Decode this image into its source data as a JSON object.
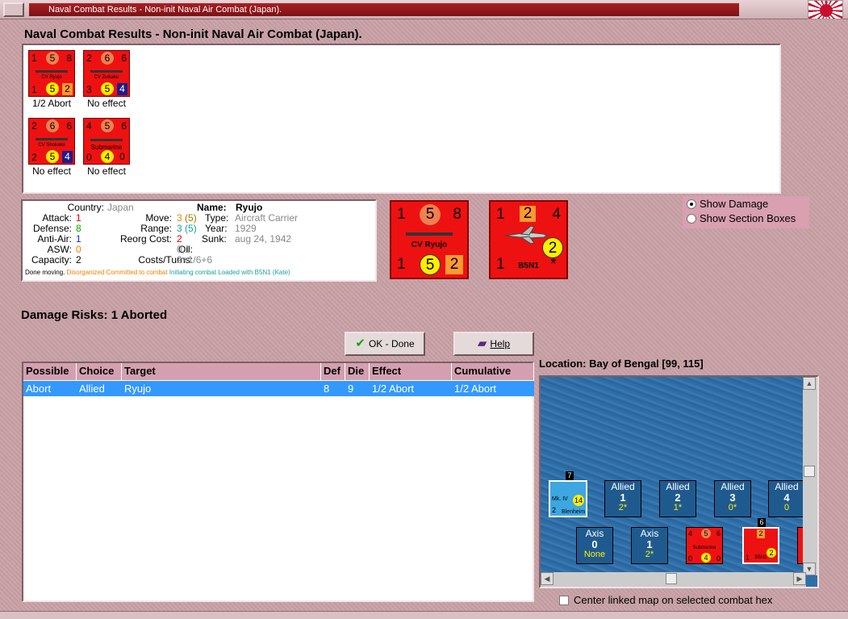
{
  "window": {
    "title": "Naval Combat Results - Non-init Naval Air Combat (Japan)."
  },
  "heading": "Naval Combat Results - Non-init Naval Air Combat (Japan).",
  "results": [
    {
      "tl": "1",
      "tc": "5",
      "tr": "8",
      "name": "CV Ryujo",
      "bl": "1",
      "bc": "5",
      "br": "2",
      "br_color": "orange",
      "label": "1/2 Abort"
    },
    {
      "tl": "2",
      "tc": "6",
      "tr": "6",
      "name": "CV Zuikaku",
      "bl": "3",
      "bc": "5",
      "br": "4",
      "br_color": "navy",
      "label": "No effect"
    },
    {
      "tl": "2",
      "tc": "6",
      "tr": "6",
      "name": "CV Shokaku",
      "bl": "2",
      "bc": "5",
      "br": "4",
      "br_color": "navy",
      "label": "No effect"
    },
    {
      "tl": "4",
      "tc": "5",
      "tr": "6",
      "name": "Submarine",
      "bl": "0",
      "bc": "4",
      "br": "0",
      "br_color": "none",
      "label": "No effect"
    }
  ],
  "info": {
    "country_label": "Country:",
    "country": "Japan",
    "attack_label": "Attack:",
    "attack": "1",
    "defense_label": "Defense:",
    "defense": "8",
    "antiair_label": "Anti-Air:",
    "antiair": "1",
    "asw_label": "ASW:",
    "asw": "0",
    "capacity_label": "Capacity:",
    "capacity": "2",
    "name_label": "Name:",
    "name": "Ryujo",
    "move_label": "Move:",
    "move": "3",
    "move_alt": "(5)",
    "range_label": "Range:",
    "range": "3",
    "range_alt": "(5)",
    "reorg_label": "Reorg Cost:",
    "reorg": "2",
    "oil_label": "Oil:",
    "oil": "0,1",
    "costs_label": "Costs/Turns:",
    "costs": "2+1/6+6",
    "type_label": "Type:",
    "type": "Aircraft Carrier",
    "year_label": "Year:",
    "year": "1929",
    "sunk_label": "Sunk:",
    "sunk": "aug 24, 1942",
    "status_1": "Done moving.",
    "status_2": "Disorganized",
    "status_3": "Committed to combat",
    "status_4": "Initiating combat",
    "status_5": "Loaded with B5N1 (Kate)"
  },
  "big_ship": {
    "tl": "1",
    "tc": "5",
    "tr": "8",
    "name": "CV Ryujo",
    "bl": "1",
    "bc": "5",
    "br": "2"
  },
  "big_plane": {
    "tl": "1",
    "tc": "2",
    "tr": "4",
    "name": "B5N1",
    "bl": "1",
    "bc": "2",
    "br": "*"
  },
  "options": {
    "show_damage": "Show Damage",
    "show_sections": "Show Section Boxes"
  },
  "damage_risks": "Damage Risks:  1 Aborted",
  "buttons": {
    "ok": "OK - Done",
    "help": "Help"
  },
  "table": {
    "headers": [
      "Possible",
      "Choice",
      "Target",
      "Def",
      "Die",
      "Effect",
      "Cumulative"
    ],
    "rows": [
      {
        "possible": "Abort",
        "choice": "Allied",
        "target": "Ryujo",
        "def": "8",
        "die": "9",
        "effect": "1/2 Abort",
        "cumulative": "1/2 Abort"
      }
    ]
  },
  "location": "Location:  Bay of Bengal [99, 115]",
  "map": {
    "plane_unit": {
      "stack": "7",
      "name": "Blenheim",
      "tag": "Mk. IV",
      "bl": "2",
      "br": "14"
    },
    "allied": [
      {
        "side": "Allied",
        "num": "1",
        "sub": "2*"
      },
      {
        "side": "Allied",
        "num": "2",
        "sub": "1*"
      },
      {
        "side": "Allied",
        "num": "3",
        "sub": "0*"
      },
      {
        "side": "Allied",
        "num": "4",
        "sub": "0"
      }
    ],
    "axis": [
      {
        "side": "Axis",
        "num": "0",
        "sub": "None"
      },
      {
        "side": "Axis",
        "num": "1",
        "sub": "2*"
      }
    ],
    "sub_unit": {
      "tl": "4",
      "tc": "5",
      "tr": "6",
      "name": "Submarine",
      "bl": "0",
      "bc": "4",
      "br": "0"
    },
    "plane_red": {
      "stack": "6",
      "tc": "2",
      "name": "B5N1",
      "bl": "1",
      "bc": "2"
    }
  },
  "center_check": "Center linked map on selected combat hex"
}
